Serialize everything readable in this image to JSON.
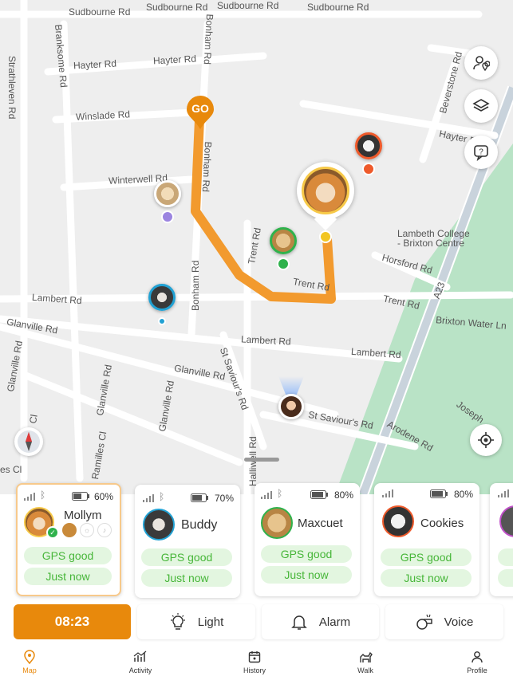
{
  "map": {
    "streets": [
      "Sudbourne Rd",
      "Sudbourne Rd",
      "Sudbourne Rd",
      "Sudbourne Rd",
      "Strathleven Rd",
      "Branksome Rd",
      "Hayter Rd",
      "Hayter Rd",
      "Bonham Rd",
      "Winslade Rd",
      "Winterwell Rd",
      "Bonham Rd",
      "Beverstone Rd",
      "Hayter Rd",
      "Lambeth College",
      "- Brixton Centre",
      "Horsford Rd",
      "Trent Rd",
      "Trent Rd",
      "Trent Rd",
      "A23",
      "Brixton Water Ln",
      "Lambert Rd",
      "Lambert Rd",
      "Lambert Rd",
      "Bonham Rd",
      "Glanville Rd",
      "Glanville Rd",
      "St Saviour's Rd",
      "Glanville Rd",
      "Glanville Rd",
      "Glanville Rd",
      "St Saviour's Rd",
      "Arodene Rd",
      "Joseph",
      "Ramilles Cl",
      "Halliwell Rd",
      "es Cl",
      "Cl"
    ],
    "go_label": "GO",
    "pets": [
      {
        "name": "shiba",
        "color": "#f7c948",
        "badge": "#f2c522"
      },
      {
        "name": "poodle",
        "color": "#9b84e0"
      },
      {
        "name": "golden",
        "color": "#2fb24c"
      },
      {
        "name": "frenchie",
        "color": "#21a1d3"
      },
      {
        "name": "cat",
        "color": "#ee5a2b"
      }
    ]
  },
  "cards": [
    {
      "name": "Mollym",
      "battery": "60%",
      "gps": "GPS good",
      "time": "Just now"
    },
    {
      "name": "Buddy",
      "battery": "70%",
      "gps": "GPS good",
      "time": "Just now"
    },
    {
      "name": "Maxcuet",
      "battery": "80%",
      "gps": "GPS good",
      "time": "Just now"
    },
    {
      "name": "Cookies",
      "battery": "80%",
      "gps": "GPS good",
      "time": "Just now"
    }
  ],
  "actions": {
    "timer": "08:23",
    "light": "Light",
    "alarm": "Alarm",
    "voice": "Voice"
  },
  "tabs": {
    "map": "Map",
    "activity": "Activity",
    "history": "History",
    "walk": "Walk",
    "profile": "Profile"
  },
  "colors": {
    "accent": "#e8890c",
    "route": "#f29a2e",
    "gps_green": "#47b639",
    "park": "#b9e3c6"
  }
}
